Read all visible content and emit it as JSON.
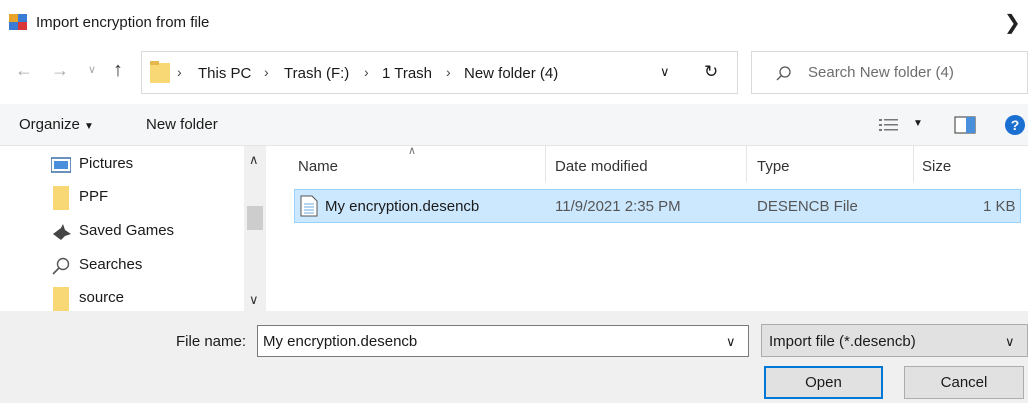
{
  "window": {
    "title": "Import encryption from file",
    "title_icon": "app-icon"
  },
  "nav": {
    "breadcrumbs": [
      "This PC",
      "Trash (F:)",
      "1 Trash",
      "New folder (4)"
    ],
    "search_placeholder": "Search New folder (4)"
  },
  "toolbar": {
    "organize_label": "Organize",
    "new_folder_label": "New folder"
  },
  "sidebar": {
    "items": [
      {
        "label": "Pictures",
        "icon": "pictures-icon"
      },
      {
        "label": "PPF",
        "icon": "folder-icon"
      },
      {
        "label": "Saved Games",
        "icon": "saved-games-icon"
      },
      {
        "label": "Searches",
        "icon": "search-icon"
      },
      {
        "label": "source",
        "icon": "folder-icon"
      }
    ]
  },
  "list": {
    "columns": [
      "Name",
      "Date modified",
      "Type",
      "Size"
    ],
    "rows": [
      {
        "name": "My encryption.desencb",
        "date": "11/9/2021 2:35 PM",
        "type": "DESENCB File",
        "size": "1 KB"
      }
    ]
  },
  "footer": {
    "file_name_label": "File name:",
    "file_name_value": "My encryption.desencb",
    "file_type": "Import file (*.desencb)",
    "open_label": "Open",
    "cancel_label": "Cancel"
  },
  "colors": {
    "selection_bg": "#cce8ff",
    "selection_border": "#99d1ff",
    "accent": "#0078d7",
    "help": "#1a6fd1"
  }
}
